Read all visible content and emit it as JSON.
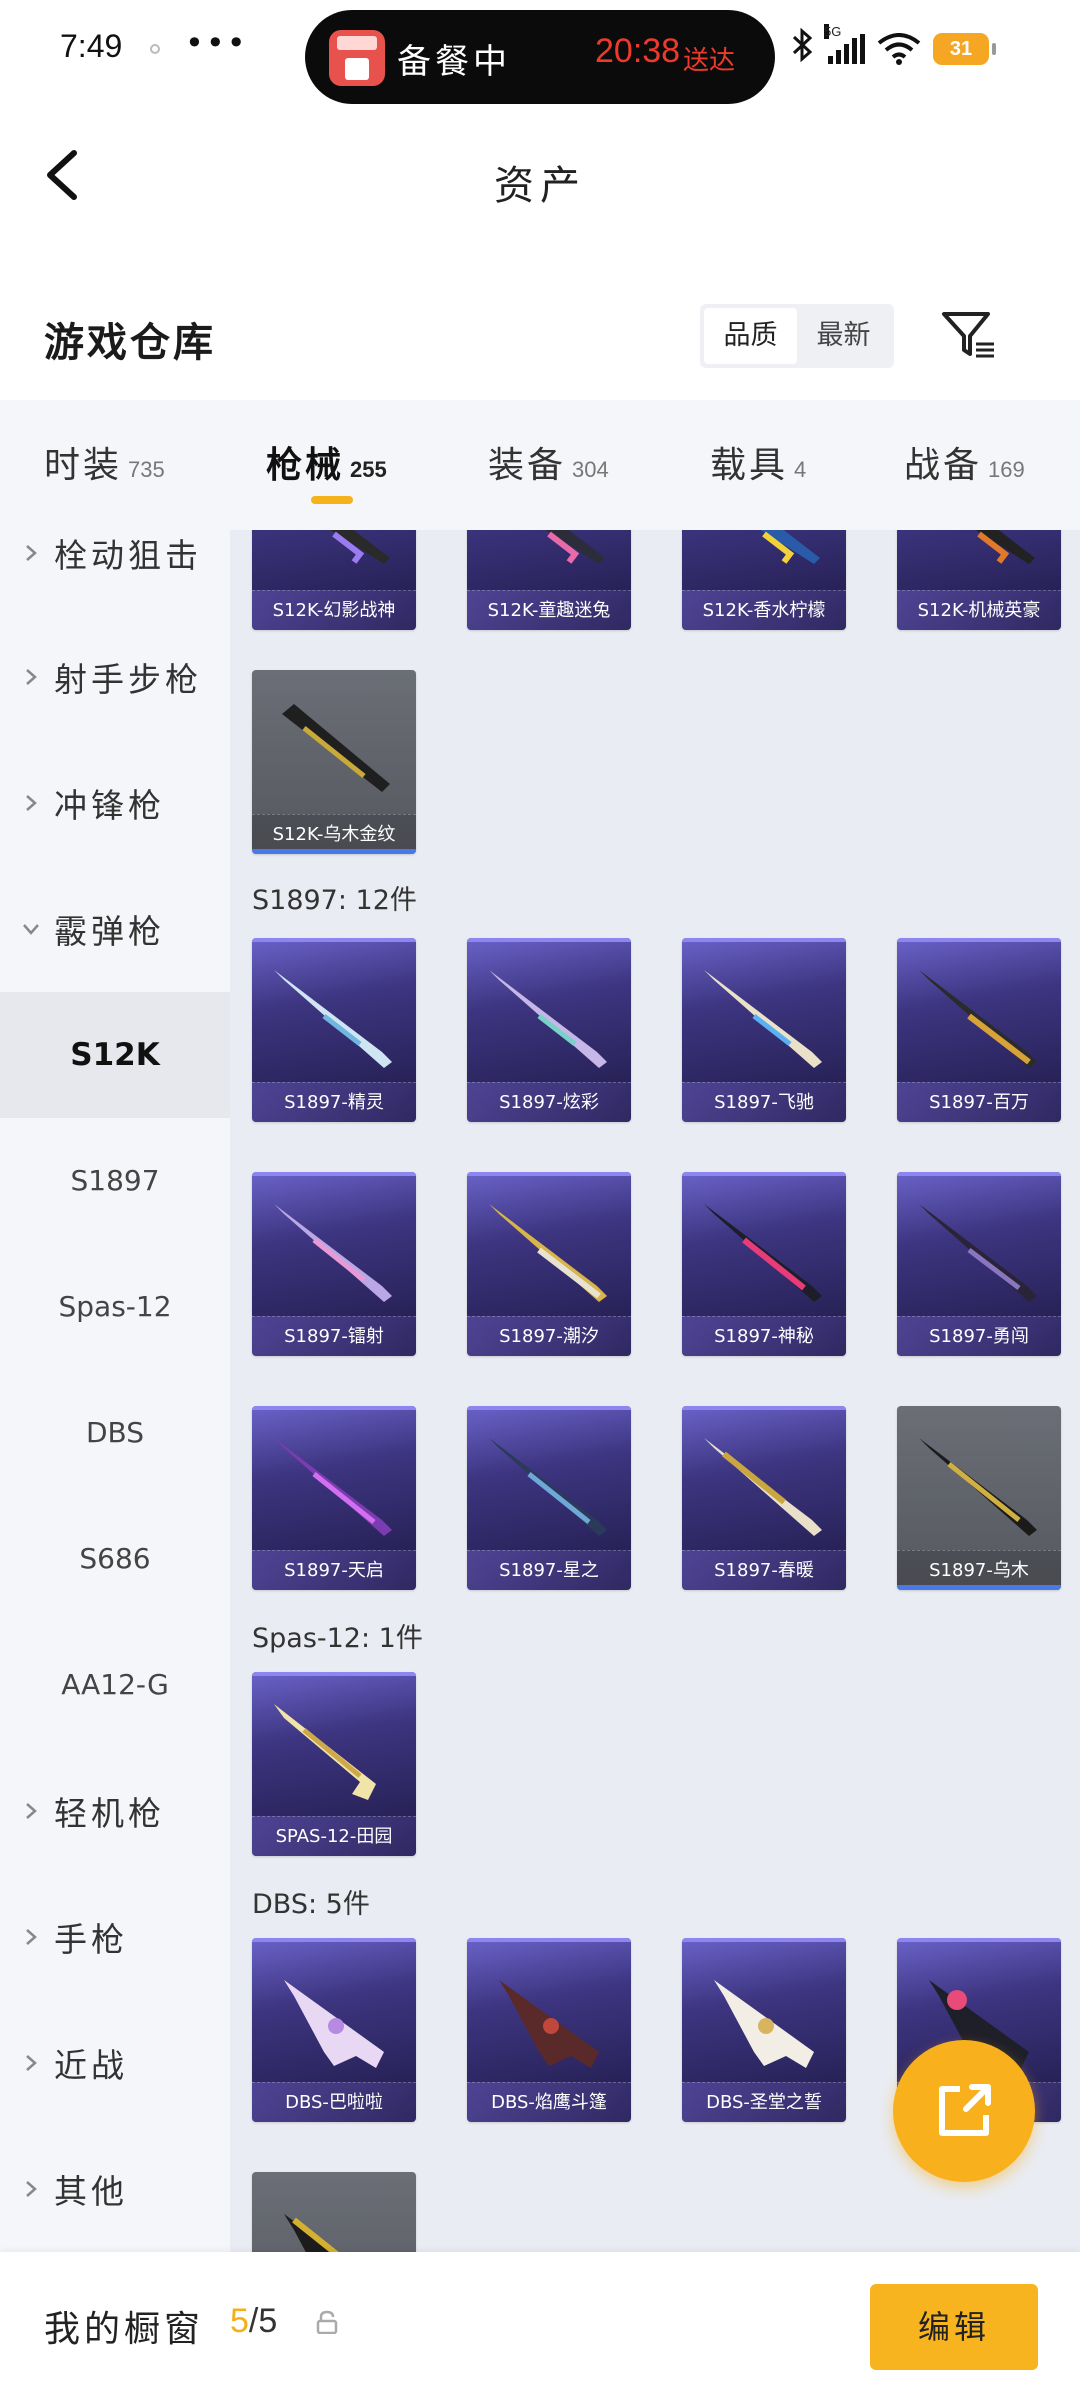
{
  "status_bar": {
    "time": "7:49",
    "more": "•••",
    "island_status": "备餐中",
    "island_time": "20:38",
    "island_eta": "送达",
    "network": "5G",
    "battery": "31"
  },
  "header": {
    "title": "资产"
  },
  "warehouse": {
    "title": "游戏仓库",
    "sort_options": [
      "品质",
      "最新"
    ],
    "active_sort": "品质"
  },
  "tabs": [
    {
      "label": "时装",
      "count": "735"
    },
    {
      "label": "枪械",
      "count": "255"
    },
    {
      "label": "装备",
      "count": "304"
    },
    {
      "label": "载具",
      "count": "4"
    },
    {
      "label": "战备",
      "count": "169"
    }
  ],
  "active_tab": "枪械",
  "sidebar": {
    "categories": [
      {
        "label": "栓动狙击",
        "expanded": false
      },
      {
        "label": "射手步枪",
        "expanded": false
      },
      {
        "label": "冲锋枪",
        "expanded": false
      },
      {
        "label": "霰弹枪",
        "expanded": true
      }
    ],
    "sub_items": [
      "S12K",
      "S1897",
      "Spas-12",
      "DBS",
      "S686",
      "AA12-G"
    ],
    "active_sub": "S12K",
    "more_categories": [
      {
        "label": "轻机枪"
      },
      {
        "label": "手枪"
      },
      {
        "label": "近战"
      },
      {
        "label": "其他"
      }
    ]
  },
  "content": {
    "s12k_top_row": [
      "S12K-幻影战神",
      "S12K-童趣迷兔",
      "S12K-香水柠檬",
      "S12K-机械英豪"
    ],
    "s12k_extra": [
      "S12K-乌木金纹"
    ],
    "s1897_title": "S1897: 12件",
    "s1897_items": [
      "S1897-精灵",
      "S1897-炫彩",
      "S1897-飞驰",
      "S1897-百万",
      "S1897-镭射",
      "S1897-潮汐",
      "S1897-神秘",
      "S1897-勇闯",
      "S1897-天启",
      "S1897-星之",
      "S1897-春暖",
      "S1897-乌木"
    ],
    "spas_title": "Spas-12: 1件",
    "spas_items": [
      "SPAS-12-田园"
    ],
    "dbs_title": "DBS: 5件",
    "dbs_items": [
      "DBS-巴啦啦",
      "DBS-焰鹰斗篷",
      "DBS-圣堂之誓",
      ""
    ]
  },
  "bottom_bar": {
    "title": "我的橱窗",
    "current": "5",
    "total": "/5",
    "edit_label": "编辑"
  },
  "colors": {
    "accent": "#f8b41f",
    "card_purple": "#3d3580",
    "card_grey": "#5f6269",
    "page_bg": "#e9ecf2"
  }
}
